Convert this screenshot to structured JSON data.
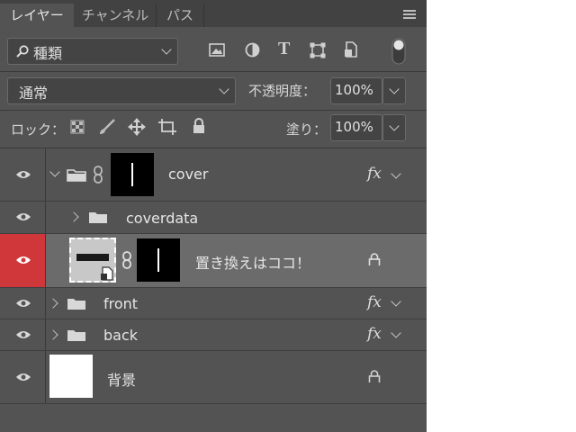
{
  "tabs": [
    {
      "label": "レイヤー",
      "active": true
    },
    {
      "label": "チャンネル",
      "active": false
    },
    {
      "label": "パス",
      "active": false
    }
  ],
  "filter": {
    "kind_label": "種類"
  },
  "blend": {
    "mode": "通常",
    "opacity_label": "不透明度：",
    "opacity_value": "100%"
  },
  "lock": {
    "label": "ロック：",
    "fill_label": "塗り：",
    "fill_value": "100%"
  },
  "layers": [
    {
      "name": "cover",
      "type": "group",
      "fx": "fx"
    },
    {
      "name": "coverdata",
      "type": "group"
    },
    {
      "name": "置き換えはココ！",
      "type": "smart-object",
      "selected": true
    },
    {
      "name": "front",
      "type": "group",
      "fx": "fx"
    },
    {
      "name": "back",
      "type": "group",
      "fx": "fx"
    },
    {
      "name": "背景",
      "type": "background"
    }
  ],
  "colors": {
    "panel": "#535353",
    "selected_row": "#6b6b6b",
    "eye_highlight": "#d0373a"
  }
}
